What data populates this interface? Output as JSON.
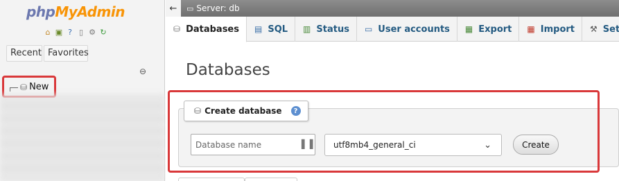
{
  "sidebar": {
    "logo_part1": "php",
    "logo_part2": "MyAdmin",
    "quick_icons": [
      "home-icon",
      "logout-icon",
      "help-icon",
      "docs-icon",
      "settings-icon",
      "reload-icon"
    ],
    "recent_label": "Recent",
    "favorites_label": "Favorites",
    "new_label": "New"
  },
  "serverbar": {
    "label": "Server: db"
  },
  "menu": {
    "tabs": [
      {
        "label": "Databases",
        "icon": "database-icon",
        "active": true
      },
      {
        "label": "SQL",
        "icon": "sql-icon"
      },
      {
        "label": "Status",
        "icon": "status-icon"
      },
      {
        "label": "User accounts",
        "icon": "user-accounts-icon"
      },
      {
        "label": "Export",
        "icon": "export-icon"
      },
      {
        "label": "Import",
        "icon": "import-icon"
      },
      {
        "label": "Set",
        "icon": "settings-icon"
      }
    ]
  },
  "main": {
    "page_title": "Databases",
    "create_db": {
      "legend": "Create database",
      "name_placeholder": "Database name",
      "collation_value": "utf8mb4_general_ci",
      "create_label": "Create"
    }
  },
  "colors": {
    "highlight": "#d9383a",
    "logo_php": "#6c78af",
    "logo_myadmin": "#f89406",
    "link": "#235a81"
  }
}
